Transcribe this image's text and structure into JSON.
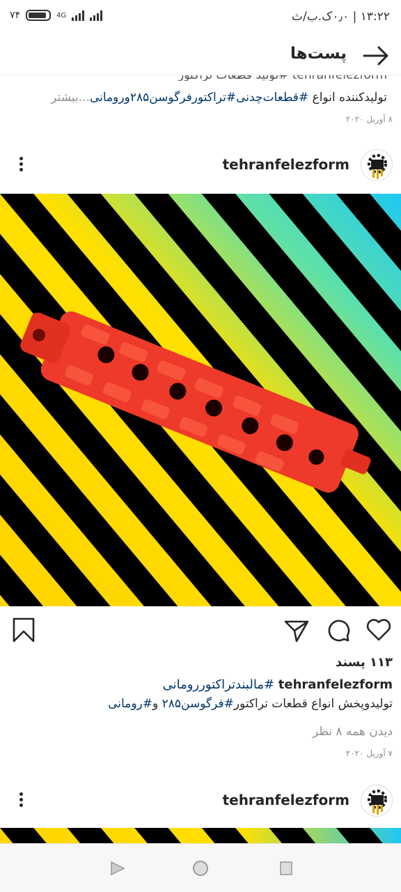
{
  "status_bar": {
    "time": "۱۳:۲۲",
    "speed": "۰٫۰ک.ب/ث",
    "battery": "۷۴",
    "network": "4G"
  },
  "header": {
    "title": "پست‌ها"
  },
  "post1": {
    "truncated_line": "tehranfelezform #تولید قطعات تراکتور",
    "caption_prefix": "تولیدکننده انواع ",
    "hashtag1": "#قطعات‌چدنی",
    "hashtag2": "#تراکتورفرگوسن۲۸۵",
    "caption_suffix": "ورومانی",
    "more": "...بیشتر",
    "date": "۸ آوریل ۲۰۲۰"
  },
  "post2": {
    "username": "tehranfelezform",
    "likes": "۱۱۳ پسند",
    "caption_user": "tehranfelezform",
    "caption_tag": "#مالبندتراکتوررومانی",
    "line2_prefix": "تولیدوپخش انواع قطعات تراکتور",
    "line2_tag1": "#فرگوسن۲۸۵",
    "line2_mid": " و",
    "line2_tag2": "#رومانی",
    "comments": "دیدن همه ۸ نظر",
    "date": "۷ آوریل ۲۰۲۰"
  },
  "post3": {
    "username": "tehranfelezform"
  },
  "icons": {
    "back": "arrow-right-icon",
    "save": "bookmark-icon",
    "share": "send-icon",
    "comment": "comment-icon",
    "like": "heart-icon",
    "more": "kebab-icon"
  },
  "colors": {
    "hashtag": "#00376b",
    "muted": "#8e8e8e",
    "part": "#ee3a2a"
  }
}
